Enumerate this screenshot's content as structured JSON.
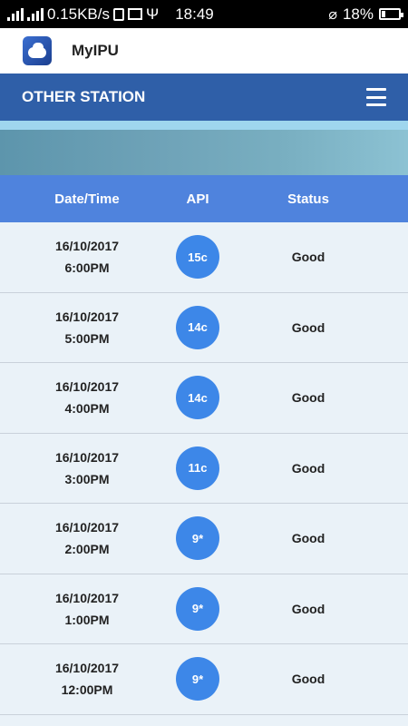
{
  "status_bar": {
    "network_speed": "0.15KB/s",
    "time": "18:49",
    "battery": "18%",
    "icons": [
      "hd-signal-icon",
      "signal-icon",
      "sim2-icon",
      "download-icon",
      "image-icon",
      "usb-icon",
      "mute-icon",
      "battery-icon"
    ]
  },
  "app_bar": {
    "title": "MyIPU",
    "logo_icon": "cloud-logo-icon"
  },
  "nav_bar": {
    "title": "OTHER STATION",
    "menu_icon": "hamburger-menu-icon"
  },
  "table": {
    "headers": {
      "date_time": "Date/Time",
      "api": "API",
      "status": "Status"
    },
    "rows": [
      {
        "date": "16/10/2017",
        "time": "6:00PM",
        "api": "15c",
        "status": "Good"
      },
      {
        "date": "16/10/2017",
        "time": "5:00PM",
        "api": "14c",
        "status": "Good"
      },
      {
        "date": "16/10/2017",
        "time": "4:00PM",
        "api": "14c",
        "status": "Good"
      },
      {
        "date": "16/10/2017",
        "time": "3:00PM",
        "api": "11c",
        "status": "Good"
      },
      {
        "date": "16/10/2017",
        "time": "2:00PM",
        "api": "9*",
        "status": "Good"
      },
      {
        "date": "16/10/2017",
        "time": "1:00PM",
        "api": "9*",
        "status": "Good"
      },
      {
        "date": "16/10/2017",
        "time": "12:00PM",
        "api": "9*",
        "status": "Good"
      }
    ]
  },
  "colors": {
    "nav_bar": "#2f5fa8",
    "table_header": "#4f83dd",
    "api_badge": "#3d87e8",
    "row_background": "#eaf2f8"
  }
}
